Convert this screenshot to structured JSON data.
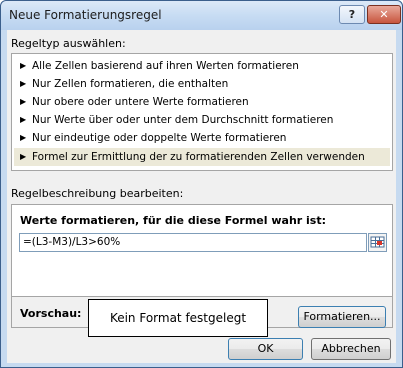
{
  "window": {
    "title": "Neue Formatierungsregel",
    "help_label": "?",
    "close_label": "✕"
  },
  "rule_type": {
    "heading": "Regeltyp auswählen:",
    "items": [
      {
        "label": "Alle Zellen basierend auf ihren Werten formatieren",
        "selected": false
      },
      {
        "label": "Nur Zellen formatieren, die enthalten",
        "selected": false
      },
      {
        "label": "Nur obere oder untere Werte formatieren",
        "selected": false
      },
      {
        "label": "Nur Werte über oder unter dem Durchschnitt formatieren",
        "selected": false
      },
      {
        "label": "Nur eindeutige oder doppelte Werte formatieren",
        "selected": false
      },
      {
        "label": "Formel zur Ermittlung der zu formatierenden Zellen verwenden",
        "selected": true
      }
    ],
    "arrow_glyph": "▶"
  },
  "description": {
    "heading": "Regelbeschreibung bearbeiten:",
    "formula_label": "Werte formatieren, für die diese Formel wahr ist:",
    "formula_value": "=(L3-M3)/L3>60%",
    "preview_label": "Vorschau:",
    "preview_text": "Kein Format festgelegt",
    "format_button": "Formatieren..."
  },
  "footer": {
    "ok_label": "OK",
    "cancel_label": "Abbrechen"
  }
}
